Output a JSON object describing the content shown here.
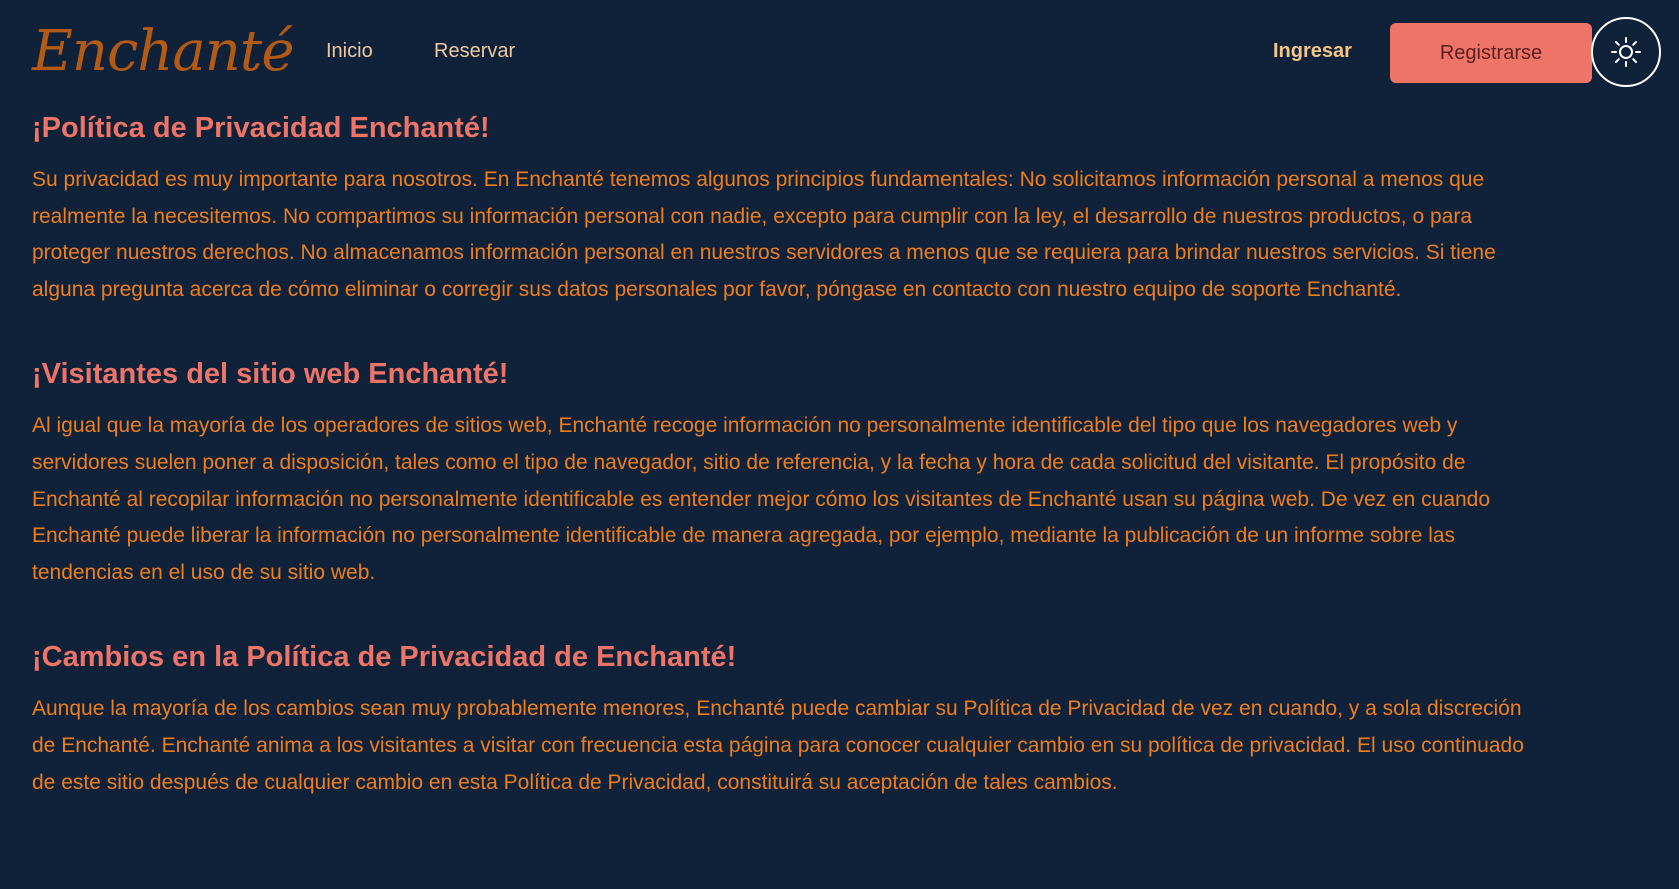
{
  "header": {
    "logo_text": "Enchanté",
    "nav": {
      "inicio": "Inicio",
      "reservar": "Reservar"
    },
    "login_label": "Ingresar",
    "register_label": "Registrarse",
    "theme_icon": "sun-icon"
  },
  "colors": {
    "background": "#0f2239",
    "heading": "#ee7468",
    "body_text": "#ef7e1a",
    "button": "#ee7468",
    "logo": "#b35a14"
  },
  "sections": [
    {
      "title": "¡Política de Privacidad Enchanté!",
      "body": "Su privacidad es muy importante para nosotros. En Enchanté tenemos algunos principios fundamentales: No solicitamos información personal a menos que realmente la necesitemos. No compartimos su información personal con nadie, excepto para cumplir con la ley, el desarrollo de nuestros productos, o para proteger nuestros derechos. No almacenamos información personal en nuestros servidores a menos que se requiera para brindar nuestros servicios. Si tiene alguna pregunta acerca de cómo eliminar o corregir sus datos personales por favor, póngase en contacto con nuestro equipo de soporte Enchanté."
    },
    {
      "title": "¡Visitantes del sitio web Enchanté!",
      "body": "Al igual que la mayoría de los operadores de sitios web, Enchanté recoge información no personalmente identificable del tipo que los navegadores web y servidores suelen poner a disposición, tales como el tipo de navegador, sitio de referencia, y la fecha y hora de cada solicitud del visitante. El propósito de Enchanté al recopilar información no personalmente identificable es entender mejor cómo los visitantes de Enchanté usan su página web. De vez en cuando Enchanté puede liberar la información no personalmente identificable de manera agregada, por ejemplo, mediante la publicación de un informe sobre las tendencias en el uso de su sitio web."
    },
    {
      "title": "¡Cambios en la Política de Privacidad de Enchanté!",
      "body": "Aunque la mayoría de los cambios sean muy probablemente menores, Enchanté puede cambiar su Política de Privacidad de vez en cuando, y a sola discreción de Enchanté. Enchanté anima a los visitantes a visitar con frecuencia esta página para conocer cualquier cambio en su política de privacidad. El uso continuado de este sitio después de cualquier cambio en esta Política de Privacidad, constituirá su aceptación de tales cambios."
    }
  ]
}
